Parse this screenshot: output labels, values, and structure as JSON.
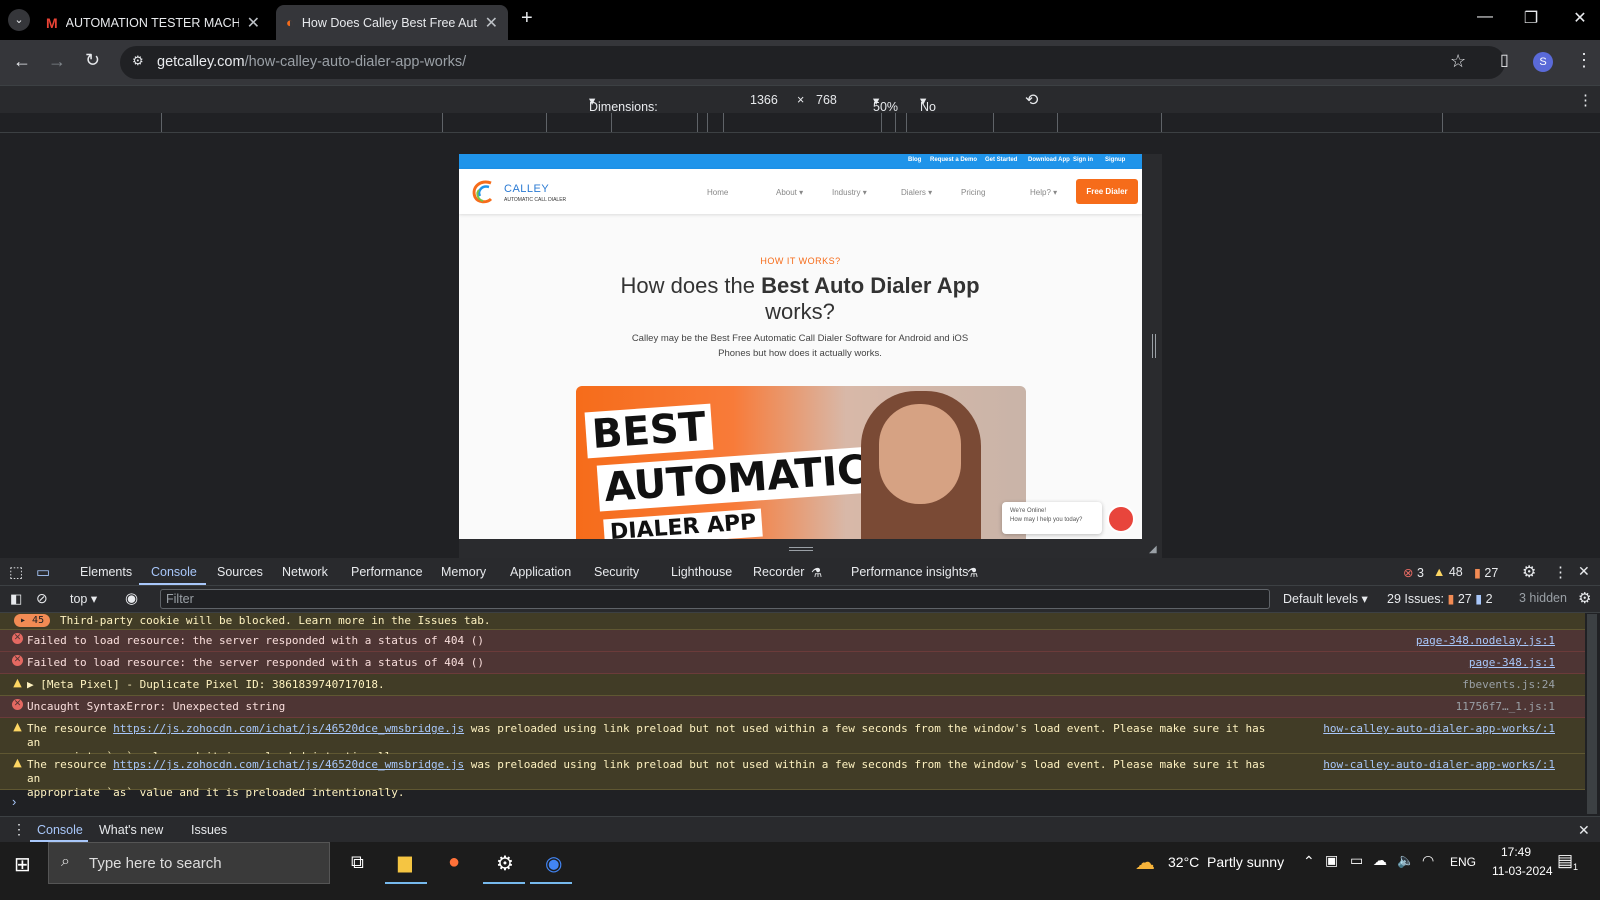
{
  "browser": {
    "tabs": [
      {
        "title": "AUTOMATION TESTER MACHIN",
        "active": false
      },
      {
        "title": "How Does Calley Best Free Auto",
        "active": true
      }
    ],
    "url_domain": "getcalley.com",
    "url_path": "/how-calley-auto-dialer-app-works/",
    "profile_initial": "S"
  },
  "device_toolbar": {
    "dimensions_label": "Dimensions: Responsive",
    "width": "1366",
    "times": "×",
    "height": "768",
    "zoom": "50%",
    "throttling": "No throttling"
  },
  "site": {
    "topbar_links": [
      "Blog",
      "Request a Demo",
      "Get Started",
      "Download App",
      "Sign in",
      "Signup"
    ],
    "logo_name": "CALLEY",
    "logo_sub": "AUTOMATIC CALL DIALER",
    "nav": [
      "Home",
      "About",
      "Industry",
      "Dialers",
      "Pricing",
      "Help?"
    ],
    "cta": "Free Dialer",
    "eyebrow": "HOW IT WORKS?",
    "title_pre": "How does the ",
    "title_bold": "Best Auto Dialer App",
    "title_post": " works?",
    "subtitle": "Calley may be the Best Free Automatic Call Dialer Software for Android and iOS Phones but how does it actually works.",
    "hero_text_1": "BEST",
    "hero_text_2": "AUTOMATIC",
    "hero_text_3": "DIALER APP",
    "chat_line_1": "We're Online!",
    "chat_line_2": "How may I help you today?"
  },
  "devtools": {
    "tabs": [
      "Elements",
      "Console",
      "Sources",
      "Network",
      "Performance",
      "Memory",
      "Application",
      "Security",
      "Lighthouse",
      "Recorder",
      "Performance insights"
    ],
    "active_tab": "Console",
    "error_count": "3",
    "warning_count": "48",
    "info_count": "27",
    "context": "top",
    "filter_placeholder": "Filter",
    "levels": "Default levels",
    "issues_label": "29 Issues:",
    "issues_a": "27",
    "issues_b": "2",
    "hidden": "3 hidden",
    "cookie_count": "45",
    "cookie_msg": "Third-party cookie will be blocked. Learn more in the Issues tab.",
    "messages": [
      {
        "level": "error",
        "text": "Failed to load resource: the server responded with a status of 404 ()",
        "source": "page-348.nodelay.js:1"
      },
      {
        "level": "error",
        "text": "Failed to load resource: the server responded with a status of 404 ()",
        "source": "page-348.js:1"
      },
      {
        "level": "warning",
        "text": "▶ [Meta Pixel] - Duplicate Pixel ID: 3861839740717018.",
        "source": "fbevents.js:24"
      },
      {
        "level": "error",
        "text": "Uncaught SyntaxError: Unexpected string",
        "source": "11756f7…_1.js:1"
      },
      {
        "level": "warning",
        "pre": "The resource ",
        "link": "https://js.zohocdn.com/ichat/js/46520dce_wmsbridge.js",
        "post": " was preloaded using link preload but not used within a few seconds from the window's load event. Please make sure it has an",
        "line2": "appropriate `as` value and it is preloaded intentionally.",
        "source": "how-calley-auto-dialer-app-works/:1"
      },
      {
        "level": "warning",
        "pre": "The resource ",
        "link": "https://js.zohocdn.com/ichat/js/46520dce_wmsbridge.js",
        "post": " was preloaded using link preload but not used within a few seconds from the window's load event. Please make sure it has an",
        "line2": "appropriate `as` value and it is preloaded intentionally.",
        "source": "how-calley-auto-dialer-app-works/:1"
      }
    ],
    "prompt": "›",
    "drawer_tabs": [
      "Console",
      "What's new",
      "Issues"
    ]
  },
  "taskbar": {
    "search_placeholder": "Type here to search",
    "weather": "32°C  Partly sunny",
    "lang": "ENG",
    "time": "17:49",
    "date": "11-03-2024",
    "notif_count": "1"
  }
}
